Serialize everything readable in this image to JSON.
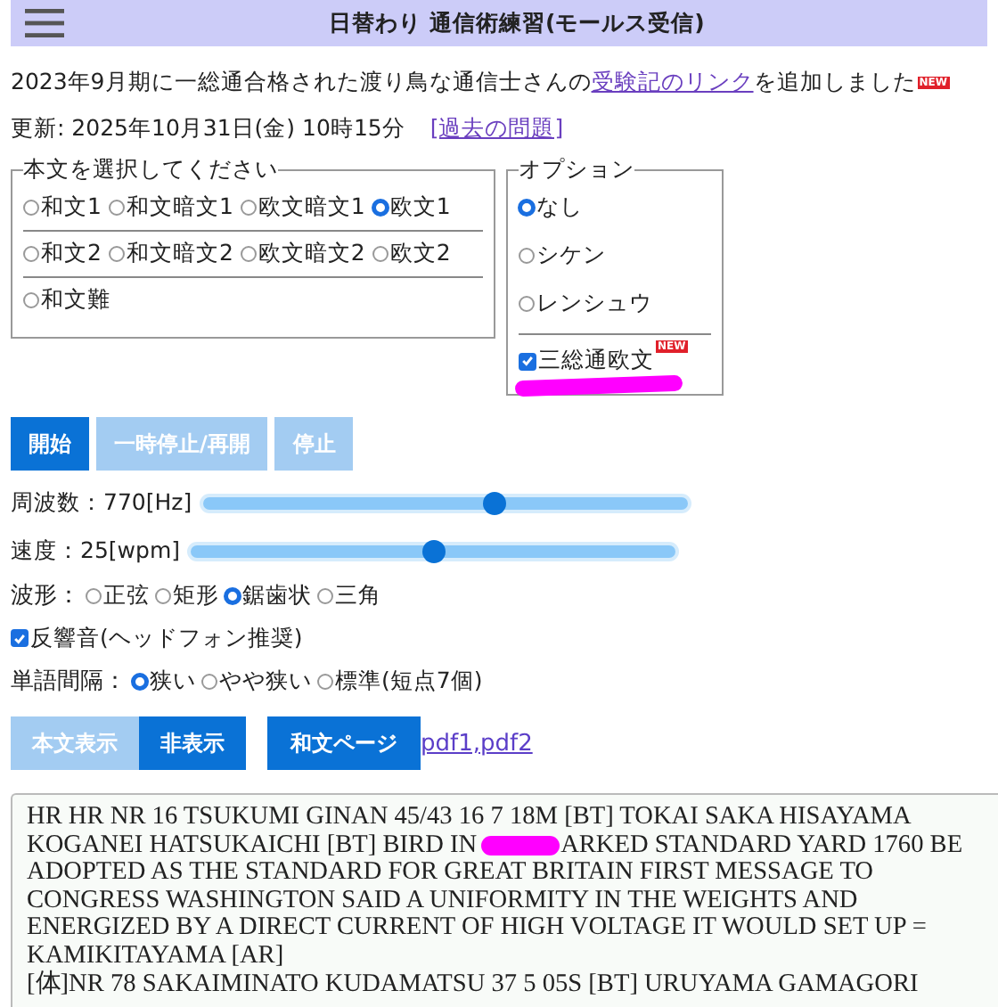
{
  "header": {
    "title": "日替わり 通信術練習(モールス受信)"
  },
  "notice": {
    "before": "2023年9月期に一総通合格された渡り鳥な通信士さんの",
    "link": "受験記のリンク",
    "after": "を追加しました",
    "badge": "NEW"
  },
  "updated": {
    "text": "更新: 2025年10月31日(金) 10時15分",
    "link": "[過去の問題]"
  },
  "text_selection": {
    "legend": "本文を選択してください",
    "rows": [
      [
        {
          "label": "和文1",
          "selected": false
        },
        {
          "label": "和文暗文1",
          "selected": false
        },
        {
          "label": "欧文暗文1",
          "selected": false
        },
        {
          "label": "欧文1",
          "selected": true
        }
      ],
      [
        {
          "label": "和文2",
          "selected": false
        },
        {
          "label": "和文暗文2",
          "selected": false
        },
        {
          "label": "欧文暗文2",
          "selected": false
        },
        {
          "label": "欧文2",
          "selected": false
        }
      ],
      [
        {
          "label": "和文難",
          "selected": false
        }
      ]
    ]
  },
  "options": {
    "legend": "オプション",
    "radios": [
      {
        "label": "なし",
        "selected": true
      },
      {
        "label": "シケン",
        "selected": false
      },
      {
        "label": "レンシュウ",
        "selected": false
      }
    ],
    "checkbox": {
      "label": "三総通欧文",
      "checked": true,
      "badge": "NEW"
    }
  },
  "controls": [
    {
      "label": "開始",
      "disabled": false
    },
    {
      "label": "一時停止/再開",
      "disabled": true
    },
    {
      "label": "停止",
      "disabled": true
    }
  ],
  "sliders": [
    {
      "label": "周波数：770[Hz]",
      "level": 0.6
    },
    {
      "label": "速度：25[wpm]",
      "level": 0.5
    }
  ],
  "waveform": {
    "label": "波形：",
    "options": [
      {
        "label": "正弦",
        "selected": false
      },
      {
        "label": "矩形",
        "selected": false
      },
      {
        "label": "鋸歯状",
        "selected": true
      },
      {
        "label": "三角",
        "selected": false
      }
    ]
  },
  "reverb": {
    "label": "反響音(ヘッドフォン推奨)",
    "checked": true
  },
  "word_gap": {
    "label": "単語間隔：",
    "options": [
      {
        "label": "狭い",
        "selected": true
      },
      {
        "label": "やや狭い",
        "selected": false
      },
      {
        "label": "標準(短点7個)",
        "selected": false
      }
    ]
  },
  "display_toggle": [
    {
      "label": "本文表示",
      "selected": false
    },
    {
      "label": "非表示",
      "selected": true
    }
  ],
  "page_button": "和文ページ",
  "pdf_link": "pdf1,pdf2",
  "message_lines": [
    {
      "text": "HR HR NR 16 TSUKUMI GINAN 45/43 16 7 18M [BT] TOKAI SAKA HISAYAMA"
    },
    {
      "text": "KOGANEI HATSUKAICHI [BT] BIRD IN",
      "rest": "ARKED STANDARD YARD 1760 BE"
    },
    {
      "text": "ADOPTED AS THE STANDARD FOR GREAT BRITAIN FIRST MESSAGE TO"
    },
    {
      "text": "CONGRESS WASHINGTON SAID A UNIFORMITY IN THE WEIGHTS AND"
    },
    {
      "text": "ENERGIZED BY A DIRECT CURRENT OF HIGH VOLTAGE IT WOULD SET UP ="
    },
    {
      "text": "KAMIKITAYAMA [AR]"
    },
    {
      "text": "[体]NR 78 SAKAIMINATO KUDAMATSU 37 5 05S [BT] URUYAMA GAMAGORI"
    }
  ]
}
